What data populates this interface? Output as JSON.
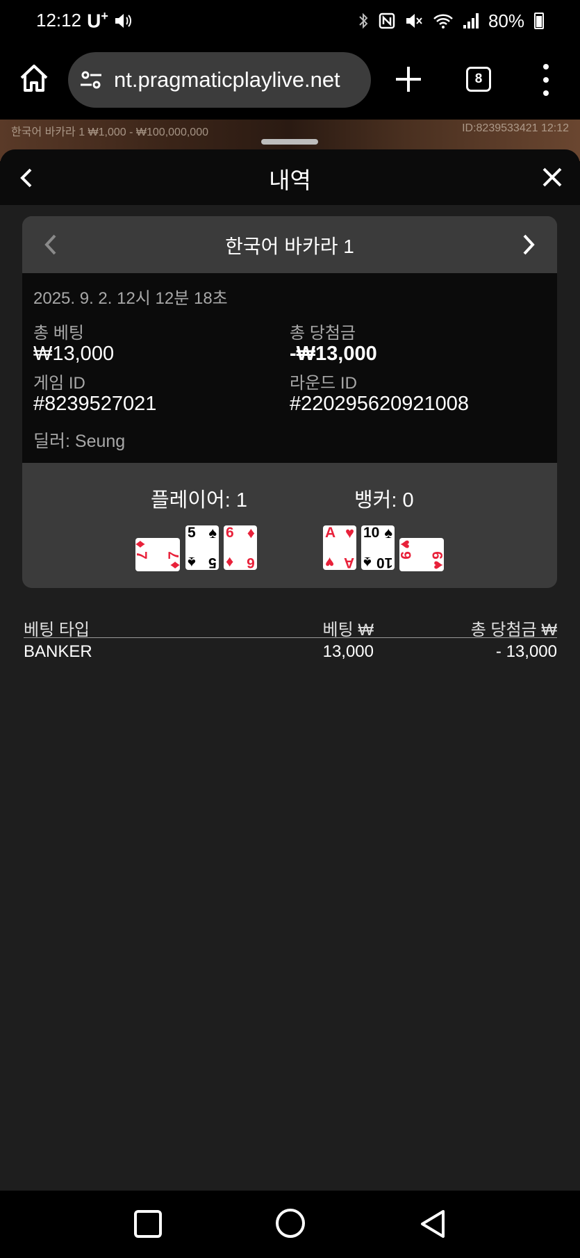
{
  "status_bar": {
    "time": "12:12",
    "carrier": "U",
    "carrier_sup": "+",
    "battery": "80%"
  },
  "browser": {
    "url": "nt.pragmaticplaylive.net",
    "tab_count": "8"
  },
  "backdrop": {
    "table_info": "한국어 바카라 1 ₩1,000 - ₩100,000,000",
    "table_id": "ID:8239533421  12:12"
  },
  "panel": {
    "title": "내역",
    "game_name": "한국어 바카라 1",
    "timestamp": "2025. 9. 2. 12시 12분 18초",
    "total_bet_label": "총 베팅",
    "total_bet_value": "₩13,000",
    "total_win_label": "총 당첨금",
    "total_win_value": "-₩13,000",
    "game_id_label": "게임 ID",
    "game_id_value": "#8239527021",
    "round_id_label": "라운드 ID",
    "round_id_value": "#220295620921008",
    "dealer": "딜러: Seung",
    "player_label": "플레이어: 1",
    "banker_label": "뱅커: 0",
    "player_cards": [
      {
        "rank": "7",
        "suit": "♦",
        "color": "#e8213a"
      },
      {
        "rank": "5",
        "suit": "♠",
        "color": "#000000"
      },
      {
        "rank": "6",
        "suit": "♦",
        "color": "#e8213a"
      }
    ],
    "banker_cards": [
      {
        "rank": "A",
        "suit": "♥",
        "color": "#e8213a"
      },
      {
        "rank": "10",
        "suit": "♠",
        "color": "#000000"
      },
      {
        "rank": "9",
        "suit": "♥",
        "color": "#e8213a"
      }
    ]
  },
  "bet_table": {
    "headers": [
      "베팅 타입",
      "베팅 ₩",
      "총 당첨금 ₩"
    ],
    "rows": [
      {
        "type": "BANKER",
        "bet": "13,000",
        "win": "- 13,000"
      }
    ]
  }
}
